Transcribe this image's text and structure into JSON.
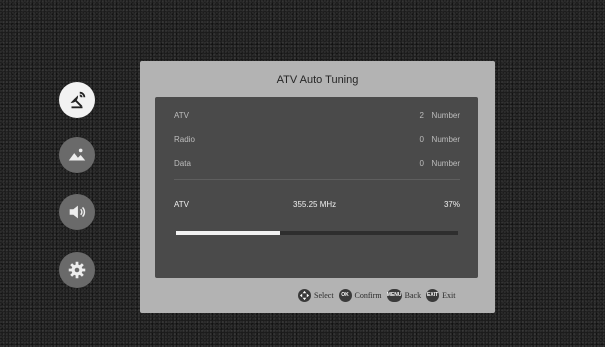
{
  "side_menu": [
    {
      "icon": "satellite-icon",
      "active": true
    },
    {
      "icon": "picture-icon",
      "active": false
    },
    {
      "icon": "sound-icon",
      "active": false
    },
    {
      "icon": "settings-icon",
      "active": false
    }
  ],
  "dialog": {
    "title": "ATV Auto Tuning",
    "rows": [
      {
        "label": "ATV",
        "count": "2",
        "unit": "Number"
      },
      {
        "label": "Radio",
        "count": "0",
        "unit": "Number"
      },
      {
        "label": "Data",
        "count": "0",
        "unit": "Number"
      }
    ],
    "scan": {
      "label": "ATV",
      "frequency": "355.25 MHz",
      "percent_text": "37%",
      "progress": 0.37
    }
  },
  "hints": [
    {
      "key": "",
      "label": "Select",
      "icon": "dpad-icon"
    },
    {
      "key": "OK",
      "label": "Confirm",
      "icon": "ok-key-icon"
    },
    {
      "key": "MENU",
      "label": "Back",
      "icon": "menu-key-icon"
    },
    {
      "key": "EXIT",
      "label": "Exit",
      "icon": "exit-key-icon"
    }
  ]
}
